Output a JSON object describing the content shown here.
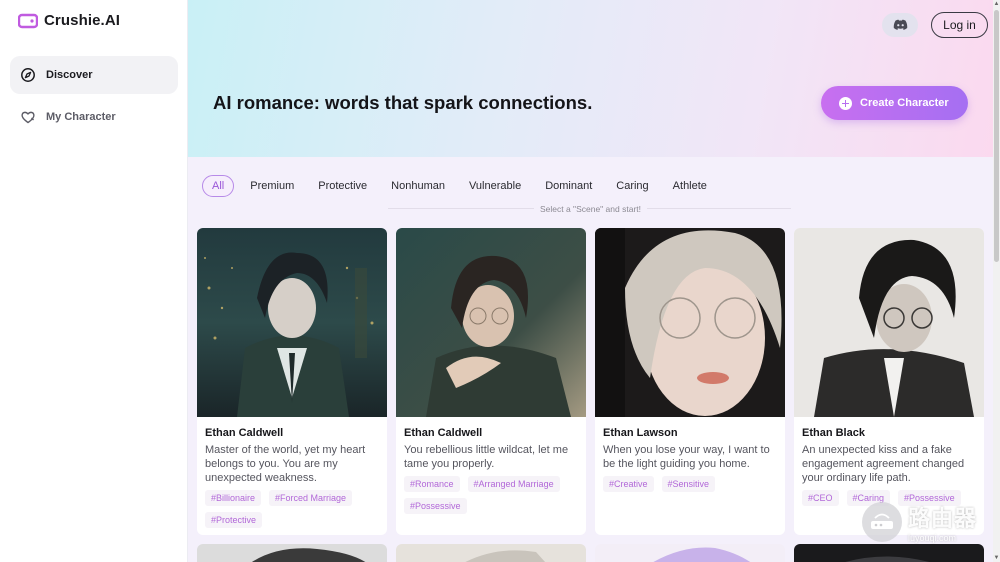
{
  "app": {
    "name": "Crushie.AI"
  },
  "sidebar": {
    "items": [
      {
        "label": "Discover",
        "icon": "compass-icon",
        "active": true
      },
      {
        "label": "My Character",
        "icon": "heart-icon",
        "active": false
      }
    ]
  },
  "header": {
    "login_label": "Log in",
    "discord_icon": "discord-icon"
  },
  "hero": {
    "title": "AI romance: words that spark connections.",
    "create_label": "Create Character"
  },
  "filters": {
    "items": [
      "All",
      "Premium",
      "Protective",
      "Nonhuman",
      "Vulnerable",
      "Dominant",
      "Caring",
      "Athlete"
    ],
    "selected": "All",
    "hint": "Select a \"Scene\" and start!"
  },
  "cards": [
    {
      "name": "Ethan Caldwell",
      "description": "Master of the world, yet my heart belongs to you. You are my unexpected weakness.",
      "tags": [
        "#Billionaire",
        "#Forced Marriage",
        "#Protective"
      ]
    },
    {
      "name": "Ethan Caldwell",
      "description": "You rebellious little wildcat, let me tame you properly.",
      "tags": [
        "#Romance",
        "#Arranged Marriage",
        "#Possessive"
      ]
    },
    {
      "name": "Ethan Lawson",
      "description": "When you lose your way, I want to be the light guiding you home.",
      "tags": [
        "#Creative",
        "#Sensitive"
      ]
    },
    {
      "name": "Ethan Black",
      "description": "An unexpected kiss and a fake engagement agreement changed your ordinary life path.",
      "tags": [
        "#CEO",
        "#Caring",
        "#Possessive"
      ]
    }
  ],
  "watermark": {
    "main": "路由器",
    "sub": "luyouqi.com"
  },
  "colors": {
    "accent": "#b06ff0",
    "tag_text": "#b268d8",
    "background": "#f4f0fb"
  }
}
